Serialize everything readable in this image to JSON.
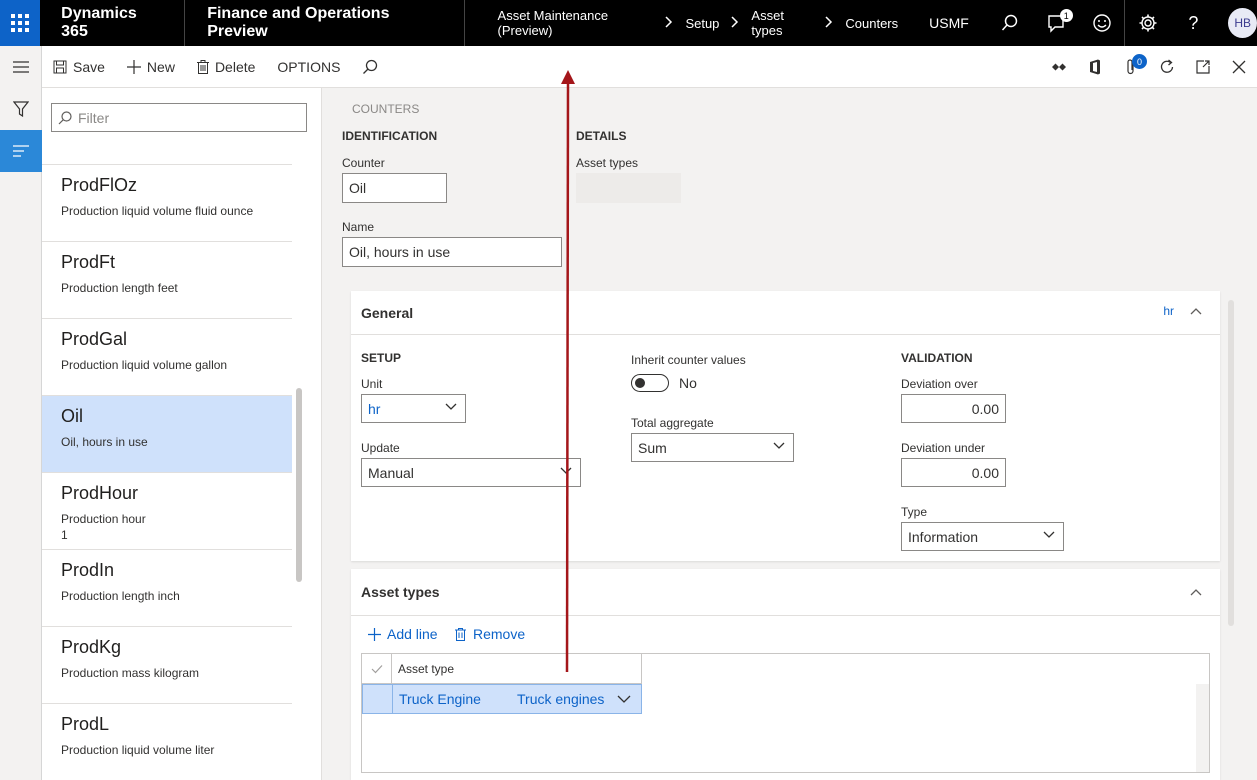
{
  "topbar": {
    "brand": "Dynamics 365",
    "product": "Finance and Operations Preview",
    "breadcrumbs": [
      "Asset Maintenance (Preview)",
      "Setup",
      "Asset types",
      "Counters"
    ],
    "company": "USMF",
    "notification_count": "1",
    "user_initials": "HB"
  },
  "actionbar": {
    "save": "Save",
    "new": "New",
    "delete": "Delete",
    "options": "OPTIONS",
    "attachments_count": "0"
  },
  "list": {
    "filter_placeholder": "Filter",
    "items": [
      {
        "title": "ProdFlOz",
        "desc": "Production liquid volume fluid ounce",
        "extra": ""
      },
      {
        "title": "ProdFt",
        "desc": "Production length feet",
        "extra": ""
      },
      {
        "title": "ProdGal",
        "desc": "Production liquid volume gallon",
        "extra": ""
      },
      {
        "title": "Oil",
        "desc": "Oil, hours in use",
        "extra": ""
      },
      {
        "title": "ProdHour",
        "desc": "Production hour",
        "extra": "1"
      },
      {
        "title": "ProdIn",
        "desc": "Production length inch",
        "extra": ""
      },
      {
        "title": "ProdKg",
        "desc": "Production mass kilogram",
        "extra": ""
      },
      {
        "title": "ProdL",
        "desc": "Production liquid volume liter",
        "extra": ""
      }
    ]
  },
  "form": {
    "section_title": "COUNTERS",
    "identification": "IDENTIFICATION",
    "details": "DETAILS",
    "counter_label": "Counter",
    "counter_value": "Oil",
    "asset_types_label": "Asset types",
    "name_label": "Name",
    "name_value": "Oil, hours in use"
  },
  "general": {
    "title": "General",
    "summary": "hr",
    "setup": "SETUP",
    "unit_label": "Unit",
    "unit_value": "hr",
    "update_label": "Update",
    "update_value": "Manual",
    "inherit_label": "Inherit counter values",
    "inherit_value": "No",
    "total_label": "Total aggregate",
    "total_value": "Sum",
    "validation": "VALIDATION",
    "dev_over_label": "Deviation over",
    "dev_over_value": "0.00",
    "dev_under_label": "Deviation under",
    "dev_under_value": "0.00",
    "type_label": "Type",
    "type_value": "Information"
  },
  "asset_types": {
    "title": "Asset types",
    "add_line": "Add line",
    "remove": "Remove",
    "col_header": "Asset type",
    "row_id": "Truck Engine",
    "row_name": "Truck engines"
  },
  "colors": {
    "accent": "#0d63c8",
    "selection": "#cfe1fb",
    "annotation_arrow": "#a4161a"
  }
}
